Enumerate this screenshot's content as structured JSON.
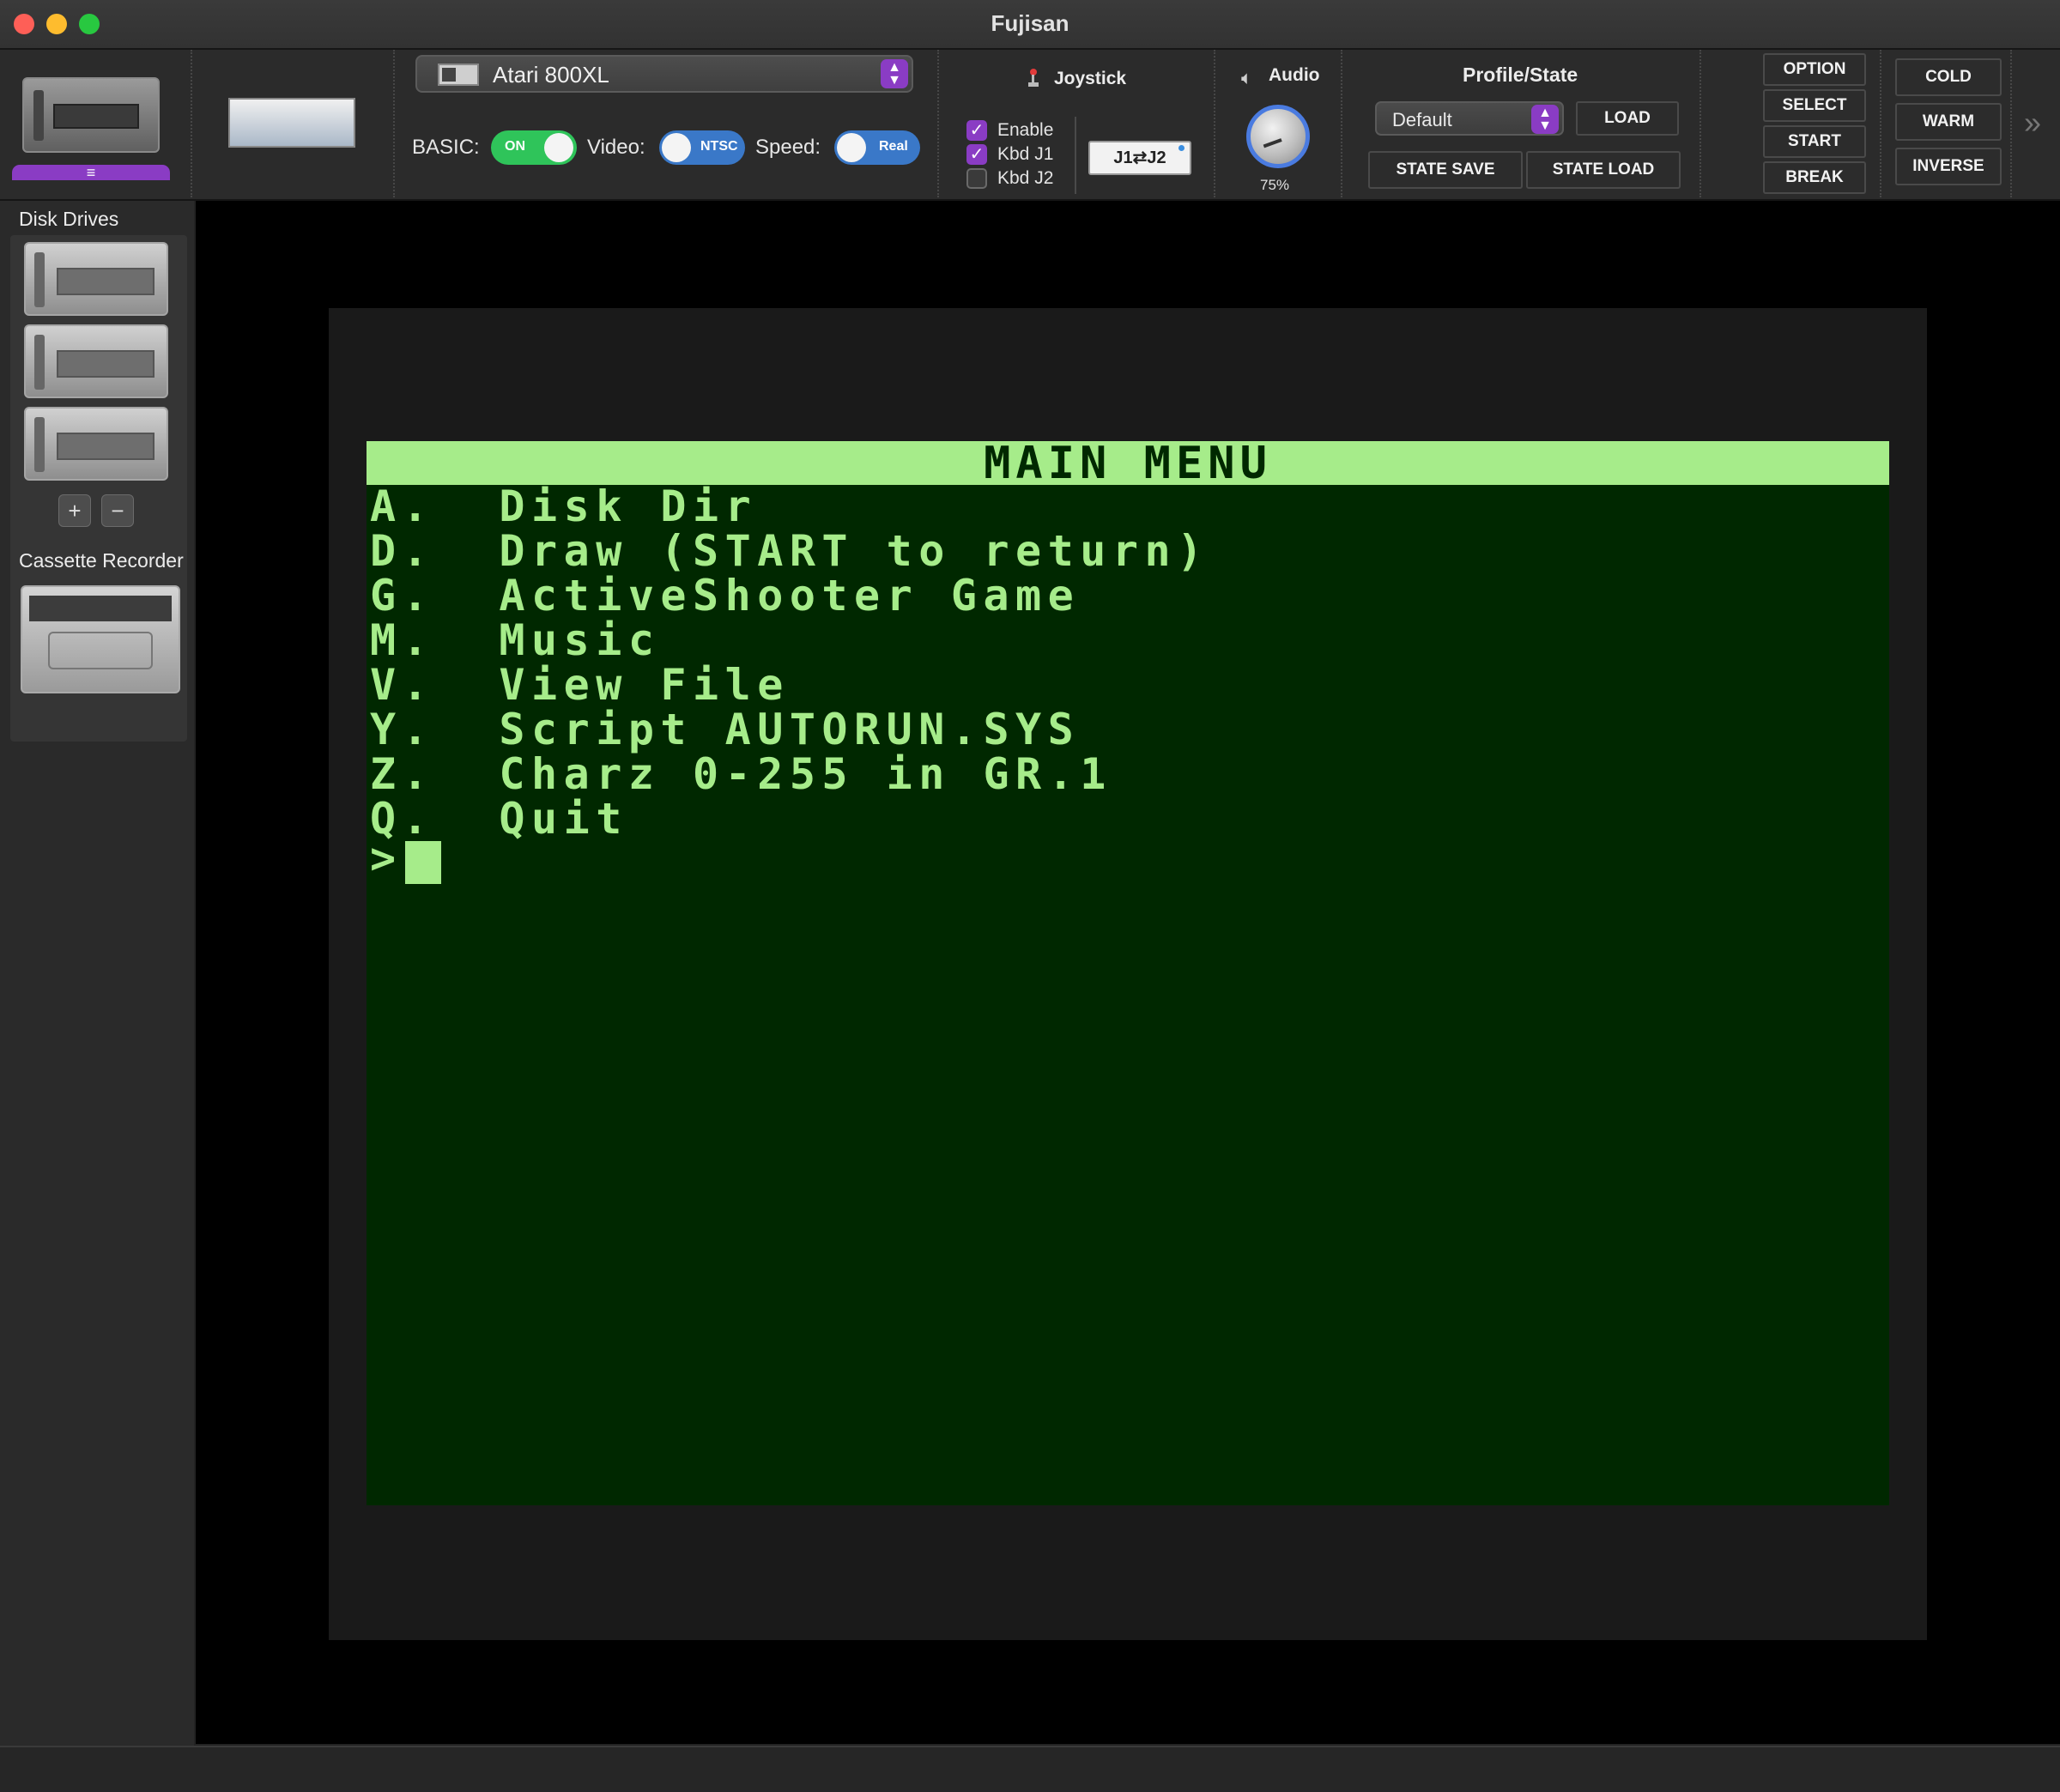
{
  "window": {
    "title": "Fujisan"
  },
  "toolbar": {
    "machine": {
      "selected": "Atari 800XL"
    },
    "basic": {
      "label": "BASIC:",
      "state": "ON"
    },
    "video": {
      "label": "Video:",
      "state": "NTSC"
    },
    "speed": {
      "label": "Speed:",
      "state": "Real"
    },
    "joystick": {
      "header": "Joystick",
      "enable": {
        "label": "Enable",
        "checked": true
      },
      "kbd_j1": {
        "label": "Kbd J1",
        "checked": true
      },
      "kbd_j2": {
        "label": "Kbd J2",
        "checked": false
      },
      "swap_button": "J1⇄J2"
    },
    "audio": {
      "header": "Audio",
      "volume": "75%"
    },
    "profile": {
      "header": "Profile/State",
      "selected": "Default",
      "load": "LOAD",
      "state_save": "STATE SAVE",
      "state_load": "STATE LOAD"
    },
    "console_keys": [
      "OPTION",
      "SELECT",
      "START",
      "BREAK"
    ],
    "reset_keys": [
      "COLD",
      "WARM",
      "INVERSE"
    ],
    "menu_glyph": "≡",
    "overflow_glyph": "»"
  },
  "sidebar": {
    "disk_drives_header": "Disk Drives",
    "add_drive": "+",
    "remove_drive": "−",
    "cassette_header": "Cassette Recorder"
  },
  "screen": {
    "title": "MAIN  MENU",
    "lines": [
      "A.  Disk Dir",
      "D.  Draw (START to return)",
      "G.  ActiveShooter Game",
      "M.  Music",
      "V.  View File",
      "Y.  Script AUTORUN.SYS",
      "Z.  Charz 0-255 in GR.1",
      "Q.  Quit"
    ],
    "prompt": ">"
  },
  "colors": {
    "accent_purple": "#8a3cc4",
    "toggle_on_green": "#2fc45a",
    "toggle_blue": "#3a78c8",
    "screen_bg": "#002800",
    "screen_fg": "#a6ec8a"
  }
}
